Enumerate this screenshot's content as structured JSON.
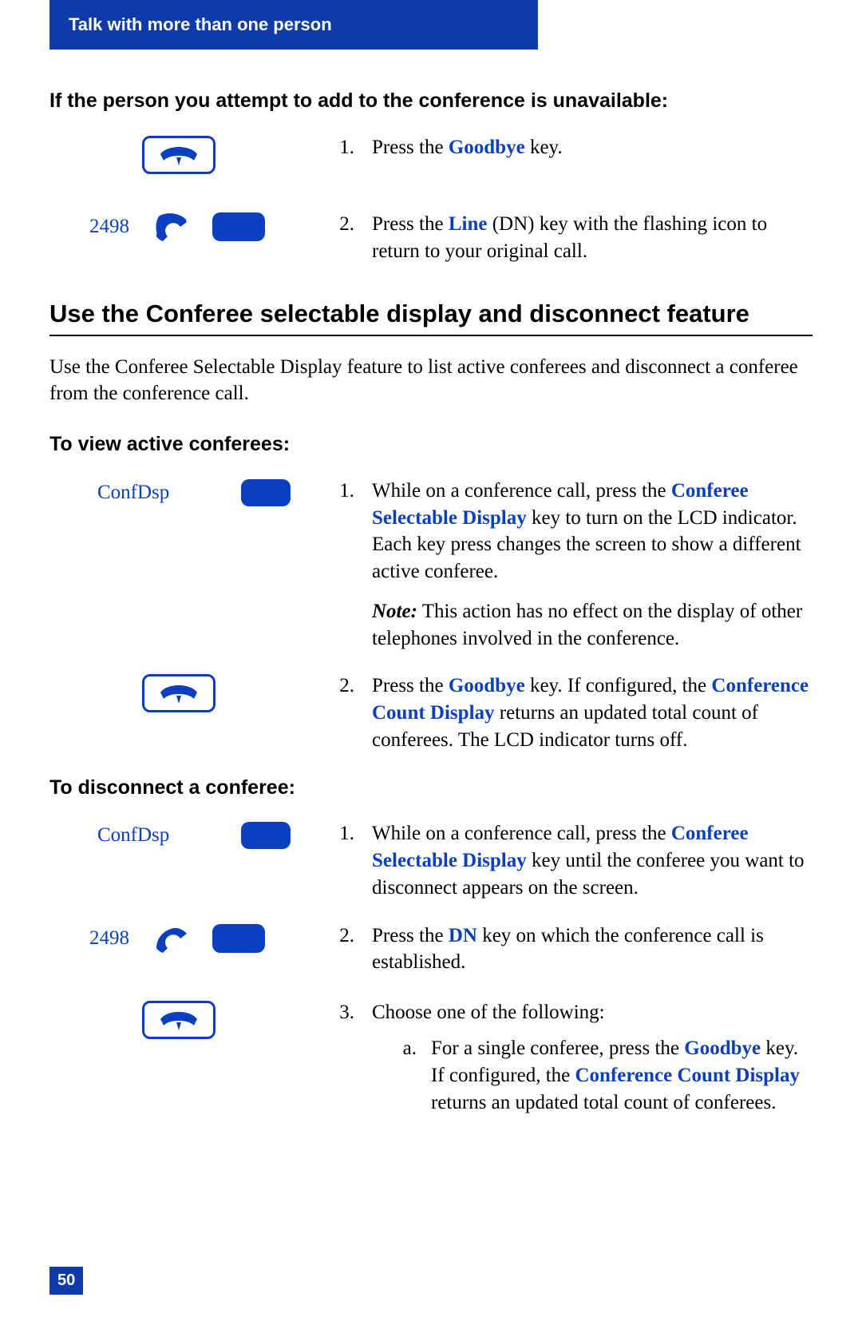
{
  "header": {
    "title": "Talk with more than one person"
  },
  "page_number": "50",
  "section1": {
    "heading": "If the person you attempt to add to the conference is unavailable:",
    "dn_label": "2498",
    "steps": {
      "s1_num": "1.",
      "s1_a": "Press the ",
      "s1_key": "Goodbye",
      "s1_b": " key.",
      "s2_num": "2.",
      "s2_a": "Press the ",
      "s2_key": "Line",
      "s2_b": " (DN) key with the flashing icon to return to your original call."
    }
  },
  "section2": {
    "title": "Use the Conferee selectable display and disconnect feature",
    "intro": "Use the Conferee Selectable Display feature to list active conferees and disconnect a conferee from the conference call.",
    "view": {
      "heading": "To view active conferees:",
      "softkey_label": "ConfDsp",
      "s1_num": "1.",
      "s1_a": "While on a conference call, press the ",
      "s1_key": "Conferee Selectable Display",
      "s1_b": " key to turn on the LCD indicator. Each key press changes the screen to show a different active conferee.",
      "note_label": "Note:",
      "note_body": " This action has no effect on the display of other telephones involved in the conference.",
      "s2_num": "2.",
      "s2_a": "Press the ",
      "s2_key1": "Goodbye",
      "s2_mid": " key. If configured, the ",
      "s2_key2": "Conference Count Display",
      "s2_b": " returns an updated total count of conferees. The LCD indicator turns off."
    },
    "disconnect": {
      "heading": "To disconnect a conferee:",
      "softkey_label": "ConfDsp",
      "dn_label": "2498",
      "s1_num": "1.",
      "s1_a": "While on a conference call, press the ",
      "s1_key": "Conferee Selectable Display",
      "s1_b": " key until the conferee you want to disconnect appears on the screen.",
      "s2_num": "2.",
      "s2_a": "Press the ",
      "s2_key": "DN",
      "s2_b": " key on which the conference call is established.",
      "s3_num": "3.",
      "s3_a": "Choose one of the following:",
      "s3a_letter": "a.",
      "s3a_a": "For a single conferee, press the ",
      "s3a_key1": "Goodbye",
      "s3a_mid": " key. If configured, the ",
      "s3a_key2": "Conference Count Display",
      "s3a_b": " returns an updated total count of conferees."
    }
  }
}
